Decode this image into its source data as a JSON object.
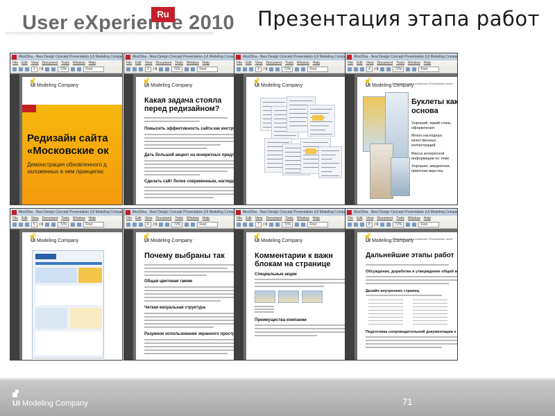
{
  "header": {
    "logo_text": "User eXperience",
    "logo_badge": "Ru",
    "logo_year": "2010",
    "slide_title": "Презентация этапа работ"
  },
  "viewer": {
    "window_title": "MosOtna - New Design Concept Presentation (UI Modeling Company).pdf - Adobe Reader",
    "menu": [
      "File",
      "Edit",
      "View",
      "Document",
      "Tools",
      "Window",
      "Help"
    ],
    "zoom": "72%",
    "find_placeholder": "Find",
    "page_total": "/ 9"
  },
  "pages": [
    {
      "page_no": "1",
      "heading_lines": [
        "Редизайн сайта",
        "«Московские ок"
      ],
      "sub_lines": [
        "Демонстрация обновленного д",
        "заложенных в нем принципах"
      ]
    },
    {
      "page_no": "2",
      "heading_lines": [
        "Какая задача стояла",
        "перед редизайном?"
      ],
      "subheads": [
        "Повысить эффективность сайта как инструм",
        "Дать большой акцент на конкретных предло",
        "Сделать сайт более современным, нагляды"
      ]
    },
    {
      "page_no": "3"
    },
    {
      "page_no": "4",
      "top_note": "Подробнее сайта компании «Московские окна»",
      "heading_lines": [
        "Буклеты как",
        "основа"
      ],
      "bullets": [
        "Хороший, яркий стиль оформления.",
        "Много наглядных качественных иллюстраций.",
        "Масса интересной информации по теме.",
        "Хорошая, аккуратная, приятная верстка."
      ]
    },
    {
      "page_no": "5"
    },
    {
      "page_no": "6",
      "heading_lines": [
        "Почему выбраны так"
      ],
      "subheads": [
        "Общая цветовая гамме",
        "Четкая визуальная структура",
        "Разумное использование экранного простра"
      ]
    },
    {
      "page_no": "7",
      "heading_lines": [
        "Комментарии к важн",
        "блокам на странице"
      ],
      "subheads": [
        "Специальные акции",
        "Преимущества компании"
      ]
    },
    {
      "page_no": "8",
      "top_note": "Подробнее сайта компании «Московские окна»",
      "heading_lines": [
        "Дальнейшие этапы работ"
      ],
      "subheads": [
        "Обсуждение, доработка и утверждение общей концепции",
        "Дизайн внутренних страниц",
        "Подготовка сопроводительной документации к дизайну"
      ]
    }
  ],
  "brand": {
    "company_bold": "UI",
    "company_rest": " Modeling Company"
  },
  "footer": {
    "page_number": "71"
  },
  "colors": {
    "accent_red": "#c3202c",
    "accent_orange": "#f6b80d",
    "logo_yellow": "#f2c020"
  }
}
